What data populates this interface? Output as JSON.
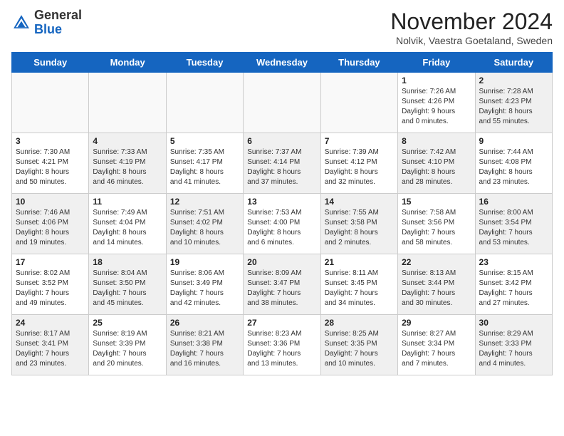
{
  "logo": {
    "text_general": "General",
    "text_blue": "Blue"
  },
  "header": {
    "month_year": "November 2024",
    "location": "Nolvik, Vaestra Goetaland, Sweden"
  },
  "days_of_week": [
    "Sunday",
    "Monday",
    "Tuesday",
    "Wednesday",
    "Thursday",
    "Friday",
    "Saturday"
  ],
  "weeks": [
    [
      {
        "day": "",
        "info": "",
        "shaded": false,
        "empty": true
      },
      {
        "day": "",
        "info": "",
        "shaded": false,
        "empty": true
      },
      {
        "day": "",
        "info": "",
        "shaded": false,
        "empty": true
      },
      {
        "day": "",
        "info": "",
        "shaded": false,
        "empty": true
      },
      {
        "day": "",
        "info": "",
        "shaded": false,
        "empty": true
      },
      {
        "day": "1",
        "info": "Sunrise: 7:26 AM\nSunset: 4:26 PM\nDaylight: 9 hours\nand 0 minutes.",
        "shaded": false,
        "empty": false
      },
      {
        "day": "2",
        "info": "Sunrise: 7:28 AM\nSunset: 4:23 PM\nDaylight: 8 hours\nand 55 minutes.",
        "shaded": true,
        "empty": false
      }
    ],
    [
      {
        "day": "3",
        "info": "Sunrise: 7:30 AM\nSunset: 4:21 PM\nDaylight: 8 hours\nand 50 minutes.",
        "shaded": false,
        "empty": false
      },
      {
        "day": "4",
        "info": "Sunrise: 7:33 AM\nSunset: 4:19 PM\nDaylight: 8 hours\nand 46 minutes.",
        "shaded": true,
        "empty": false
      },
      {
        "day": "5",
        "info": "Sunrise: 7:35 AM\nSunset: 4:17 PM\nDaylight: 8 hours\nand 41 minutes.",
        "shaded": false,
        "empty": false
      },
      {
        "day": "6",
        "info": "Sunrise: 7:37 AM\nSunset: 4:14 PM\nDaylight: 8 hours\nand 37 minutes.",
        "shaded": true,
        "empty": false
      },
      {
        "day": "7",
        "info": "Sunrise: 7:39 AM\nSunset: 4:12 PM\nDaylight: 8 hours\nand 32 minutes.",
        "shaded": false,
        "empty": false
      },
      {
        "day": "8",
        "info": "Sunrise: 7:42 AM\nSunset: 4:10 PM\nDaylight: 8 hours\nand 28 minutes.",
        "shaded": true,
        "empty": false
      },
      {
        "day": "9",
        "info": "Sunrise: 7:44 AM\nSunset: 4:08 PM\nDaylight: 8 hours\nand 23 minutes.",
        "shaded": false,
        "empty": false
      }
    ],
    [
      {
        "day": "10",
        "info": "Sunrise: 7:46 AM\nSunset: 4:06 PM\nDaylight: 8 hours\nand 19 minutes.",
        "shaded": true,
        "empty": false
      },
      {
        "day": "11",
        "info": "Sunrise: 7:49 AM\nSunset: 4:04 PM\nDaylight: 8 hours\nand 14 minutes.",
        "shaded": false,
        "empty": false
      },
      {
        "day": "12",
        "info": "Sunrise: 7:51 AM\nSunset: 4:02 PM\nDaylight: 8 hours\nand 10 minutes.",
        "shaded": true,
        "empty": false
      },
      {
        "day": "13",
        "info": "Sunrise: 7:53 AM\nSunset: 4:00 PM\nDaylight: 8 hours\nand 6 minutes.",
        "shaded": false,
        "empty": false
      },
      {
        "day": "14",
        "info": "Sunrise: 7:55 AM\nSunset: 3:58 PM\nDaylight: 8 hours\nand 2 minutes.",
        "shaded": true,
        "empty": false
      },
      {
        "day": "15",
        "info": "Sunrise: 7:58 AM\nSunset: 3:56 PM\nDaylight: 7 hours\nand 58 minutes.",
        "shaded": false,
        "empty": false
      },
      {
        "day": "16",
        "info": "Sunrise: 8:00 AM\nSunset: 3:54 PM\nDaylight: 7 hours\nand 53 minutes.",
        "shaded": true,
        "empty": false
      }
    ],
    [
      {
        "day": "17",
        "info": "Sunrise: 8:02 AM\nSunset: 3:52 PM\nDaylight: 7 hours\nand 49 minutes.",
        "shaded": false,
        "empty": false
      },
      {
        "day": "18",
        "info": "Sunrise: 8:04 AM\nSunset: 3:50 PM\nDaylight: 7 hours\nand 45 minutes.",
        "shaded": true,
        "empty": false
      },
      {
        "day": "19",
        "info": "Sunrise: 8:06 AM\nSunset: 3:49 PM\nDaylight: 7 hours\nand 42 minutes.",
        "shaded": false,
        "empty": false
      },
      {
        "day": "20",
        "info": "Sunrise: 8:09 AM\nSunset: 3:47 PM\nDaylight: 7 hours\nand 38 minutes.",
        "shaded": true,
        "empty": false
      },
      {
        "day": "21",
        "info": "Sunrise: 8:11 AM\nSunset: 3:45 PM\nDaylight: 7 hours\nand 34 minutes.",
        "shaded": false,
        "empty": false
      },
      {
        "day": "22",
        "info": "Sunrise: 8:13 AM\nSunset: 3:44 PM\nDaylight: 7 hours\nand 30 minutes.",
        "shaded": true,
        "empty": false
      },
      {
        "day": "23",
        "info": "Sunrise: 8:15 AM\nSunset: 3:42 PM\nDaylight: 7 hours\nand 27 minutes.",
        "shaded": false,
        "empty": false
      }
    ],
    [
      {
        "day": "24",
        "info": "Sunrise: 8:17 AM\nSunset: 3:41 PM\nDaylight: 7 hours\nand 23 minutes.",
        "shaded": true,
        "empty": false
      },
      {
        "day": "25",
        "info": "Sunrise: 8:19 AM\nSunset: 3:39 PM\nDaylight: 7 hours\nand 20 minutes.",
        "shaded": false,
        "empty": false
      },
      {
        "day": "26",
        "info": "Sunrise: 8:21 AM\nSunset: 3:38 PM\nDaylight: 7 hours\nand 16 minutes.",
        "shaded": true,
        "empty": false
      },
      {
        "day": "27",
        "info": "Sunrise: 8:23 AM\nSunset: 3:36 PM\nDaylight: 7 hours\nand 13 minutes.",
        "shaded": false,
        "empty": false
      },
      {
        "day": "28",
        "info": "Sunrise: 8:25 AM\nSunset: 3:35 PM\nDaylight: 7 hours\nand 10 minutes.",
        "shaded": true,
        "empty": false
      },
      {
        "day": "29",
        "info": "Sunrise: 8:27 AM\nSunset: 3:34 PM\nDaylight: 7 hours\nand 7 minutes.",
        "shaded": false,
        "empty": false
      },
      {
        "day": "30",
        "info": "Sunrise: 8:29 AM\nSunset: 3:33 PM\nDaylight: 7 hours\nand 4 minutes.",
        "shaded": true,
        "empty": false
      }
    ]
  ]
}
